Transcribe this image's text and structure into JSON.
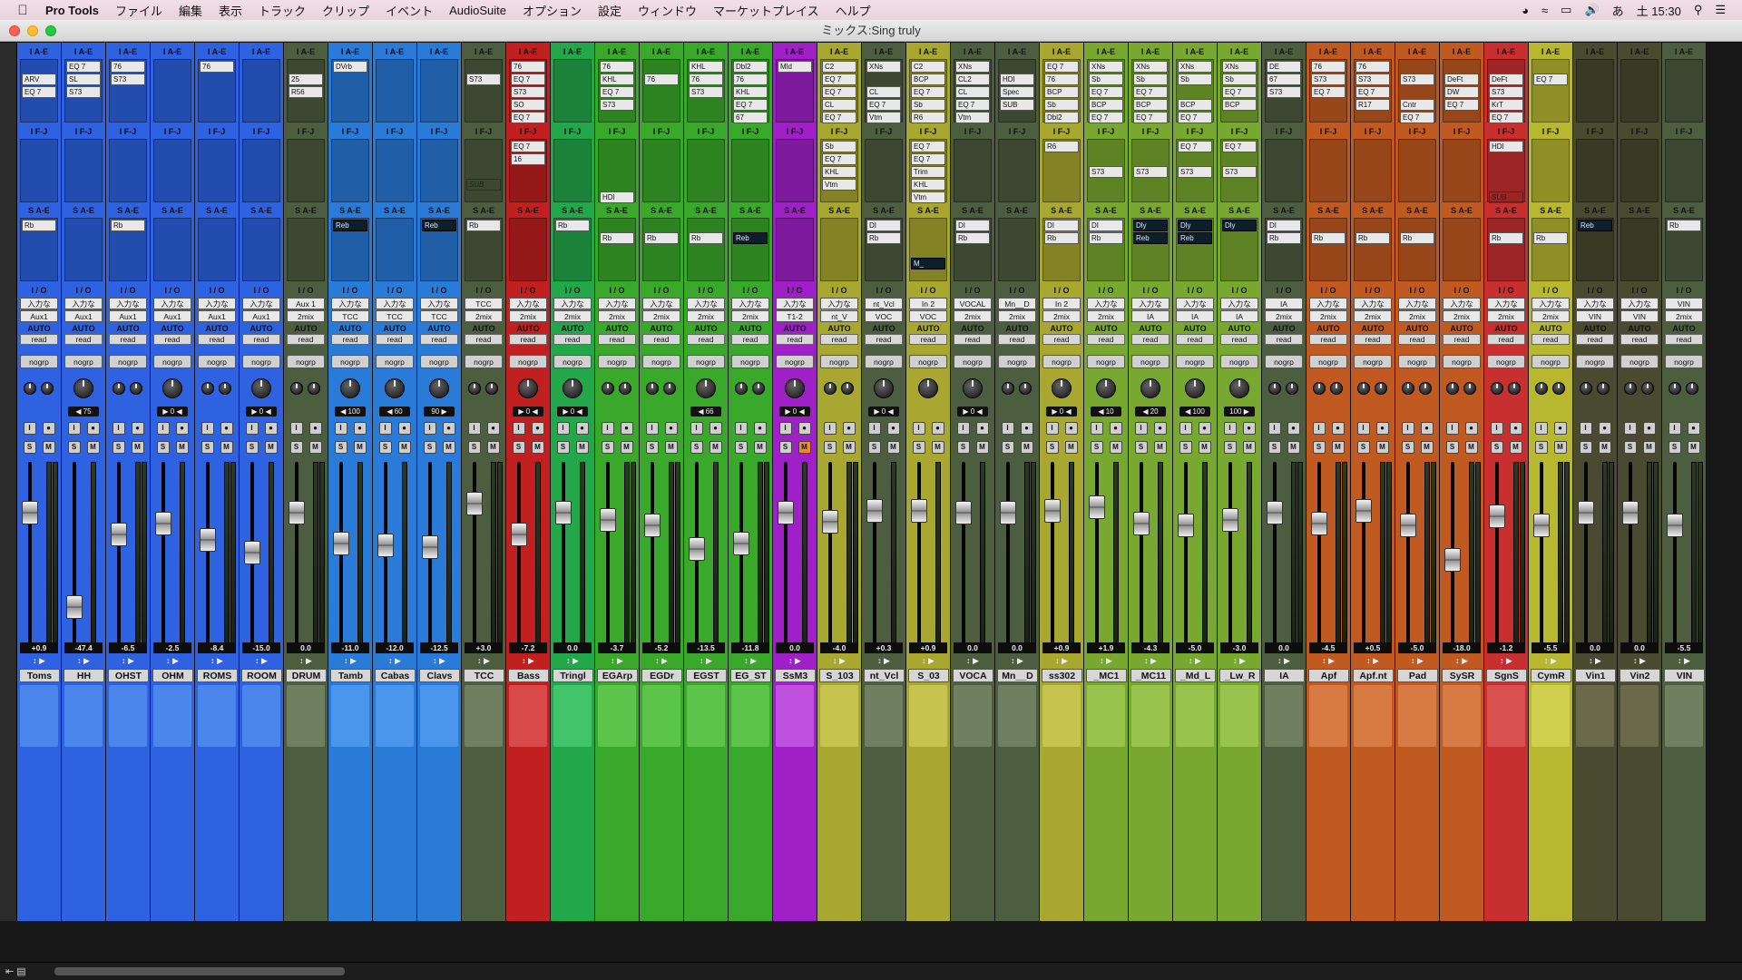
{
  "menubar": {
    "app": "Pro Tools",
    "items": [
      "ファイル",
      "編集",
      "表示",
      "トラック",
      "クリップ",
      "イベント",
      "AudioSuite",
      "オプション",
      "設定",
      "ウィンドウ",
      "マーケットプレイス",
      "ヘルプ"
    ],
    "clock": "土 15:30"
  },
  "window": {
    "title": "ミックス:Sing truly"
  },
  "labels": {
    "inserts_ae": "I A-E",
    "inserts_fj": "I F-J",
    "sends_ae": "S A-E",
    "io": "I / O",
    "auto": "AUTO",
    "read": "read",
    "group": "nogrp"
  },
  "tracks": [
    {
      "name": "Toms",
      "color": "#2e62e0",
      "bar": "#4a86ec",
      "ins": [
        "",
        "ARV",
        "EQ 7"
      ],
      "fj": [],
      "sends": [
        "Rb"
      ],
      "in": "入力な",
      "out": "Aux1",
      "vol": "+0.9",
      "pan": "",
      "stereo": true,
      "fader": 0.72
    },
    {
      "name": "HH",
      "color": "#2e62e0",
      "bar": "#4a86ec",
      "ins": [
        "EQ 7",
        "SL",
        "S73"
      ],
      "fj": [],
      "sends": [],
      "in": "入力な",
      "out": "Aux1",
      "vol": "-47.4",
      "pan": "◀ 75",
      "stereo": false,
      "fader": 0.2
    },
    {
      "name": "OHST",
      "color": "#2e62e0",
      "bar": "#4a86ec",
      "ins": [
        "76",
        "S73"
      ],
      "fj": [],
      "sends": [
        "Rb"
      ],
      "in": "入力な",
      "out": "Aux1",
      "vol": "-6.5",
      "pan": "",
      "stereo": true,
      "fader": 0.6
    },
    {
      "name": "OHM",
      "color": "#2e62e0",
      "bar": "#4a86ec",
      "ins": [],
      "fj": [],
      "sends": [],
      "in": "入力な",
      "out": "Aux1",
      "vol": "-2.5",
      "pan": "▶ 0 ◀",
      "stereo": false,
      "fader": 0.66
    },
    {
      "name": "ROMS",
      "color": "#2e62e0",
      "bar": "#4a86ec",
      "ins": [
        "76"
      ],
      "fj": [],
      "sends": [],
      "in": "入力な",
      "out": "Aux1",
      "vol": "-8.4",
      "pan": "",
      "stereo": true,
      "fader": 0.57
    },
    {
      "name": "ROOM",
      "color": "#2e62e0",
      "bar": "#4a86ec",
      "ins": [],
      "fj": [],
      "sends": [],
      "in": "入力な",
      "out": "Aux1",
      "vol": "-15.0",
      "pan": "▶ 0 ◀",
      "stereo": false,
      "fader": 0.5
    },
    {
      "name": "DRUM",
      "color": "#4d5d40",
      "bar": "#6f7f5f",
      "ins": [
        "",
        "25",
        "R56"
      ],
      "fj": [],
      "sends": [],
      "in": "Aux 1",
      "out": "2mix",
      "vol": "0.0",
      "pan": "",
      "stereo": true,
      "fader": 0.72
    },
    {
      "name": "Tamb",
      "color": "#2a7ad8",
      "bar": "#4a96ec",
      "ins": [
        "DVrb"
      ],
      "fj": [],
      "sends": [
        "Reb"
      ],
      "in": "入力な",
      "out": "TCC",
      "vol": "-11.0",
      "pan": "◀ 100",
      "stereo": false,
      "fader": 0.55
    },
    {
      "name": "Cabas",
      "color": "#2a7ad8",
      "bar": "#4a96ec",
      "ins": [],
      "fj": [],
      "sends": [],
      "in": "入力な",
      "out": "TCC",
      "vol": "-12.0",
      "pan": "◀ 60",
      "stereo": false,
      "fader": 0.54
    },
    {
      "name": "Clavs",
      "color": "#2a7ad8",
      "bar": "#4a96ec",
      "ins": [],
      "fj": [],
      "sends": [
        "Reb"
      ],
      "in": "入力な",
      "out": "TCC",
      "vol": "-12.5",
      "pan": "90 ▶",
      "stereo": false,
      "fader": 0.53
    },
    {
      "name": "TCC",
      "color": "#4d5d40",
      "bar": "#6f7f5f",
      "ins": [
        "",
        "S73"
      ],
      "fj": [
        "",
        "",
        "",
        "SUB"
      ],
      "sends": [
        "Rb"
      ],
      "in": "TCC",
      "out": "2mix",
      "vol": "+3.0",
      "pan": "",
      "stereo": true,
      "fader": 0.77
    },
    {
      "name": "Bass",
      "color": "#c02020",
      "bar": "#d84a4a",
      "ins": [
        "76",
        "EQ 7",
        "S73",
        "SO",
        "EQ 7"
      ],
      "fj": [
        "EQ 7",
        "16"
      ],
      "sends": [],
      "in": "入力な",
      "out": "2mix",
      "vol": "-7.2",
      "pan": "▶ 0 ◀",
      "stereo": false,
      "fader": 0.6
    },
    {
      "name": "Tringl",
      "color": "#22a84a",
      "bar": "#44c46a",
      "ins": [],
      "fj": [],
      "sends": [
        "Rb"
      ],
      "in": "入力な",
      "out": "2mix",
      "vol": "0.0",
      "pan": "▶ 0 ◀",
      "stereo": false,
      "fader": 0.72
    },
    {
      "name": "EGArp",
      "color": "#3aa82a",
      "bar": "#5cc44a",
      "ins": [
        "76",
        "KHL",
        "EQ 7",
        "S73"
      ],
      "fj": [
        "",
        "",
        "",
        "",
        "HDI"
      ],
      "sends": [
        "",
        "Rb"
      ],
      "in": "入力な",
      "out": "2mix",
      "vol": "-3.7",
      "pan": "",
      "stereo": true,
      "fader": 0.68
    },
    {
      "name": "EGDr",
      "color": "#3aa82a",
      "bar": "#5cc44a",
      "ins": [
        "",
        "76"
      ],
      "fj": [],
      "sends": [
        "",
        "Rb"
      ],
      "in": "入力な",
      "out": "2mix",
      "vol": "-5.2",
      "pan": "",
      "stereo": true,
      "fader": 0.65
    },
    {
      "name": "EGST",
      "color": "#3aa82a",
      "bar": "#5cc44a",
      "ins": [
        "KHL",
        "76",
        "S73"
      ],
      "fj": [],
      "sends": [
        "",
        "Rb"
      ],
      "in": "入力な",
      "out": "2mix",
      "vol": "-13.5",
      "pan": "◀ 66",
      "stereo": false,
      "fader": 0.52
    },
    {
      "name": "EG_ST",
      "color": "#3aa82a",
      "bar": "#5cc44a",
      "ins": [
        "Dbl2",
        "76",
        "KHL",
        "EQ 7",
        "67"
      ],
      "fj": [],
      "sends": [
        "",
        "Reb"
      ],
      "in": "入力な",
      "out": "2mix",
      "vol": "-11.8",
      "pan": "",
      "stereo": true,
      "fader": 0.55
    },
    {
      "name": "SsM3",
      "color": "#a020c8",
      "bar": "#c050e0",
      "ins": [
        "Mld"
      ],
      "fj": [],
      "sends": [],
      "in": "入力な",
      "out": "T1-2",
      "vol": "0.0",
      "pan": "▶ 0 ◀",
      "stereo": false,
      "fader": 0.72,
      "muted": true
    },
    {
      "name": "S_103",
      "color": "#a8a830",
      "bar": "#c4c44e",
      "ins": [
        "C2",
        "EQ 7",
        "EQ 7",
        "CL",
        "EQ 7"
      ],
      "fj": [
        "Sb",
        "EQ 7",
        "KHL",
        "Vtm"
      ],
      "sends": [],
      "in": "入力な",
      "out": "nt_V",
      "vol": "-4.0",
      "pan": "",
      "stereo": true,
      "fader": 0.67
    },
    {
      "name": "nt_Vcl",
      "color": "#4d5d40",
      "bar": "#6f7f5f",
      "ins": [
        "XNs",
        "",
        "CL",
        "EQ 7",
        "Vtm"
      ],
      "fj": [],
      "sends": [
        "DI",
        "Rb"
      ],
      "in": "nt_Vcl",
      "out": "VOC",
      "vol": "+0.3",
      "pan": "▶ 0 ◀",
      "stereo": false,
      "fader": 0.73
    },
    {
      "name": "S_03",
      "color": "#a8a830",
      "bar": "#c4c44e",
      "ins": [
        "C2",
        "BCP",
        "EQ 7",
        "Sb",
        "R6"
      ],
      "fj": [
        "EQ 7",
        "EQ 7",
        "Trim",
        "KHL",
        "Vtm"
      ],
      "sends": [
        "",
        "",
        "",
        "M_"
      ],
      "in": "In 2",
      "out": "VOC",
      "vol": "+0.9",
      "pan": "",
      "stereo": false,
      "fader": 0.73
    },
    {
      "name": "VOCA",
      "color": "#4d5d40",
      "bar": "#6f7f5f",
      "ins": [
        "XNs",
        "CL2",
        "CL",
        "EQ 7",
        "Vtm"
      ],
      "fj": [],
      "sends": [
        "DI",
        "Rb"
      ],
      "in": "VOCAL",
      "out": "2mix",
      "vol": "0.0",
      "pan": "▶ 0 ◀",
      "stereo": false,
      "fader": 0.72
    },
    {
      "name": "Mn__D",
      "color": "#4d5d40",
      "bar": "#6f7f5f",
      "ins": [
        "",
        "HDI",
        "Spec",
        "SUB"
      ],
      "fj": [],
      "sends": [],
      "in": "Mn__D",
      "out": "2mix",
      "vol": "0.0",
      "pan": "",
      "stereo": true,
      "fader": 0.72
    },
    {
      "name": "ss302",
      "color": "#a8a830",
      "bar": "#c4c44e",
      "ins": [
        "EQ 7",
        "76",
        "BCP",
        "Sb",
        "Dbl2"
      ],
      "fj": [
        "R6"
      ],
      "sends": [
        "DI",
        "Rb"
      ],
      "in": "In 2",
      "out": "2mix",
      "vol": "+0.9",
      "pan": "▶ 0 ◀",
      "stereo": false,
      "fader": 0.73
    },
    {
      "name": "_MC1",
      "color": "#78a830",
      "bar": "#98c44e",
      "ins": [
        "XNs",
        "Sb",
        "EQ 7",
        "BCP",
        "EQ 7"
      ],
      "fj": [
        "",
        "",
        "S73"
      ],
      "sends": [
        "DI",
        "Rb"
      ],
      "in": "入力な",
      "out": "2mix",
      "vol": "+1.9",
      "pan": "◀ 10",
      "stereo": false,
      "fader": 0.75
    },
    {
      "name": "_MC11",
      "color": "#78a830",
      "bar": "#98c44e",
      "ins": [
        "XNs",
        "Sb",
        "EQ 7",
        "BCP",
        "EQ 7"
      ],
      "fj": [
        "",
        "",
        "S73"
      ],
      "sends": [
        "Dly",
        "Reb"
      ],
      "in": "入力な",
      "out": "IA",
      "vol": "-4.3",
      "pan": "◀ 20",
      "stereo": false,
      "fader": 0.66
    },
    {
      "name": "_Md_L",
      "color": "#78a830",
      "bar": "#98c44e",
      "ins": [
        "XNs",
        "Sb",
        "",
        "BCP",
        "EQ 7"
      ],
      "fj": [
        "EQ 7",
        "",
        "S73"
      ],
      "sends": [
        "Dly",
        "Reb"
      ],
      "in": "入力な",
      "out": "IA",
      "vol": "-5.0",
      "pan": "◀ 100",
      "stereo": false,
      "fader": 0.65
    },
    {
      "name": "_Lw_R",
      "color": "#78a830",
      "bar": "#98c44e",
      "ins": [
        "XNs",
        "Sb",
        "EQ 7",
        "BCP"
      ],
      "fj": [
        "EQ 7",
        "",
        "S73"
      ],
      "sends": [
        "Dly"
      ],
      "in": "入力な",
      "out": "IA",
      "vol": "-3.0",
      "pan": "100 ▶",
      "stereo": false,
      "fader": 0.68
    },
    {
      "name": "IA",
      "color": "#4d5d40",
      "bar": "#6f7f5f",
      "ins": [
        "DE",
        "67",
        "S73"
      ],
      "fj": [],
      "sends": [
        "DI",
        "Rb"
      ],
      "in": "IA",
      "out": "2mix",
      "vol": "0.0",
      "pan": "",
      "stereo": true,
      "fader": 0.72
    },
    {
      "name": "Apf",
      "color": "#c05a20",
      "bar": "#d87a44",
      "ins": [
        "76",
        "S73",
        "EQ 7"
      ],
      "fj": [],
      "sends": [
        "",
        "Rb"
      ],
      "in": "入力な",
      "out": "2mix",
      "vol": "-4.5",
      "pan": "",
      "stereo": true,
      "fader": 0.66
    },
    {
      "name": "Apf.nt",
      "color": "#c05a20",
      "bar": "#d87a44",
      "ins": [
        "76",
        "S73",
        "EQ 7",
        "R17"
      ],
      "fj": [],
      "sends": [
        "",
        "Rb"
      ],
      "in": "入力な",
      "out": "2mix",
      "vol": "+0.5",
      "pan": "",
      "stereo": true,
      "fader": 0.73
    },
    {
      "name": "Pad",
      "color": "#c05a20",
      "bar": "#d87a44",
      "ins": [
        "",
        "S73",
        "",
        "Cntr",
        "EQ 7"
      ],
      "fj": [],
      "sends": [
        "",
        "Rb"
      ],
      "in": "入力な",
      "out": "2mix",
      "vol": "-5.0",
      "pan": "",
      "stereo": true,
      "fader": 0.65
    },
    {
      "name": "SySR",
      "color": "#c05a20",
      "bar": "#d87a44",
      "ins": [
        "",
        "DeFt",
        "DW",
        "EQ 7"
      ],
      "fj": [],
      "sends": [],
      "in": "入力な",
      "out": "2mix",
      "vol": "-18.0",
      "pan": "",
      "stereo": true,
      "fader": 0.46
    },
    {
      "name": "SgnS",
      "color": "#c83030",
      "bar": "#d85050",
      "ins": [
        "",
        "DeFt",
        "S73",
        "KrT",
        "EQ 7"
      ],
      "fj": [
        "HDI",
        "",
        "",
        "",
        "SUB"
      ],
      "sends": [
        "",
        "Rb"
      ],
      "in": "入力な",
      "out": "2mix",
      "vol": "-1.2",
      "pan": "",
      "stereo": true,
      "fader": 0.7
    },
    {
      "name": "CymR",
      "color": "#b8b830",
      "bar": "#d0d050",
      "ins": [
        "",
        "EQ 7"
      ],
      "fj": [],
      "sends": [
        "",
        "Rb"
      ],
      "in": "入力な",
      "out": "2mix",
      "vol": "-5.5",
      "pan": "",
      "stereo": true,
      "fader": 0.65
    },
    {
      "name": "Vin1",
      "color": "#4a4a30",
      "bar": "#6a6a4a",
      "ins": [],
      "fj": [],
      "sends": [
        "Reb"
      ],
      "in": "入力な",
      "out": "VIN",
      "vol": "0.0",
      "pan": "",
      "stereo": true,
      "fader": 0.72
    },
    {
      "name": "Vin2",
      "color": "#4a4a30",
      "bar": "#6a6a4a",
      "ins": [],
      "fj": [],
      "sends": [],
      "in": "入力な",
      "out": "VIN",
      "vol": "0.0",
      "pan": "",
      "stereo": true,
      "fader": 0.72
    },
    {
      "name": "VIN",
      "color": "#4d5d40",
      "bar": "#6f7f5f",
      "ins": [],
      "fj": [],
      "sends": [
        "Rb"
      ],
      "in": "VIN",
      "out": "2mix",
      "vol": "-5.5",
      "pan": "",
      "stereo": true,
      "fader": 0.65
    }
  ]
}
